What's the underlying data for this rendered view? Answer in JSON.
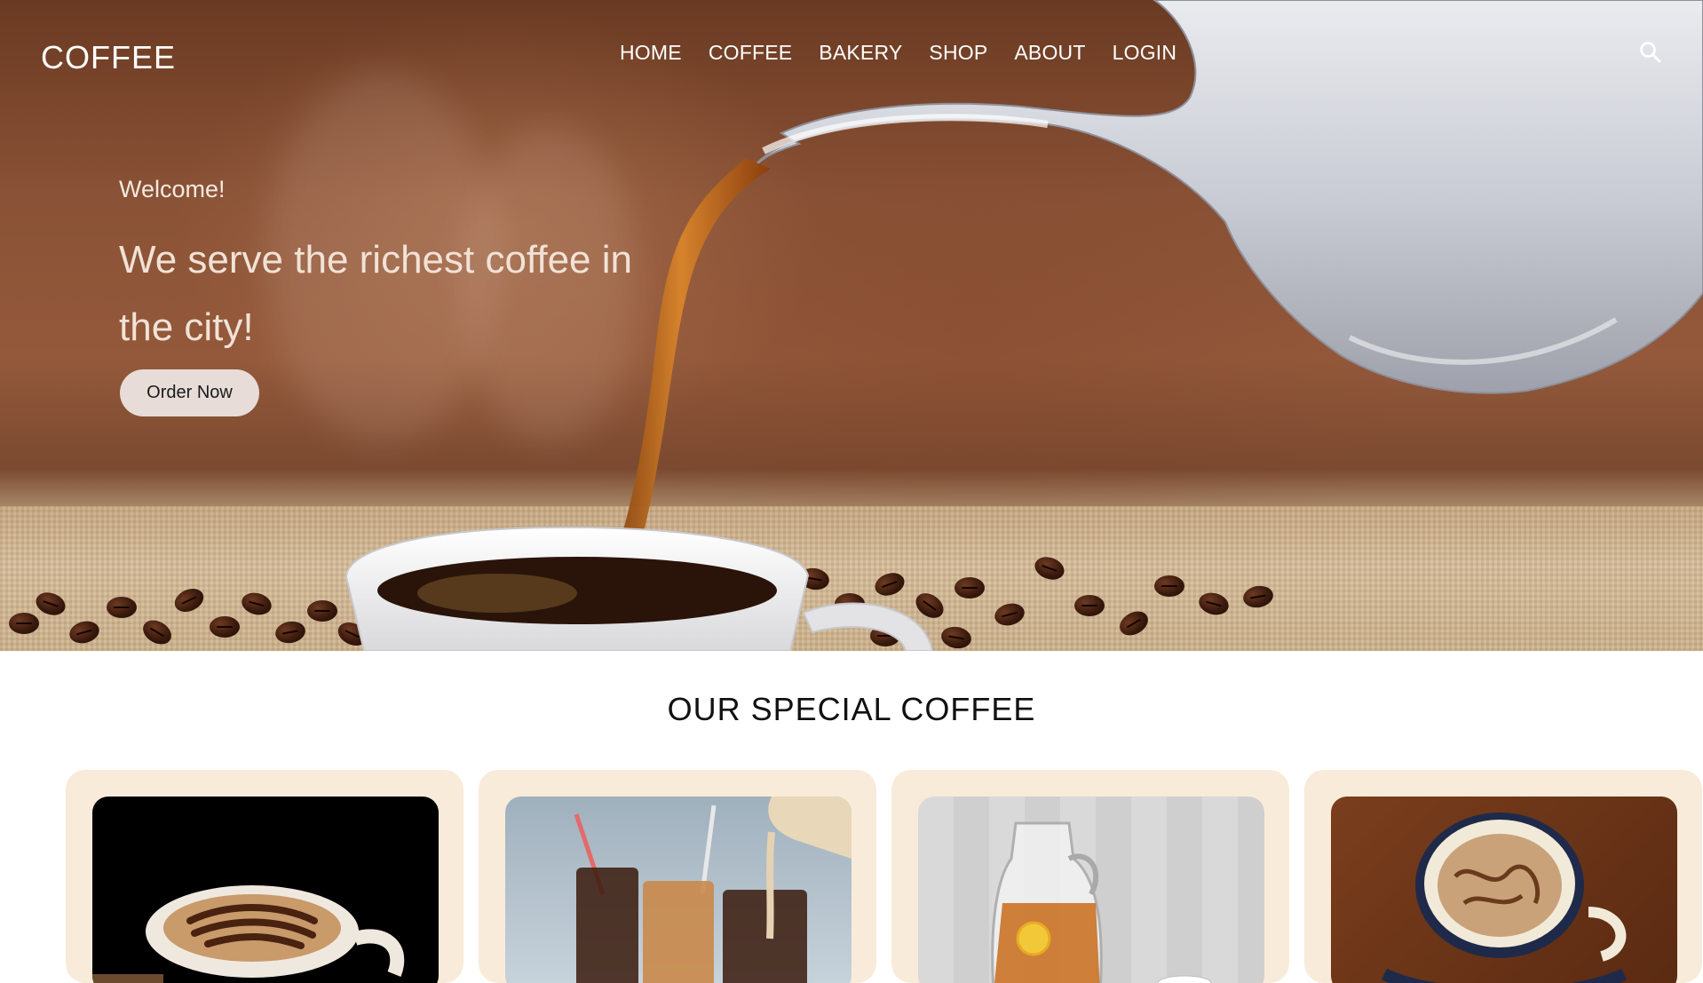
{
  "brand": {
    "logo": "COFFEE"
  },
  "nav": {
    "items": [
      {
        "label": "HOME"
      },
      {
        "label": "COFFEE"
      },
      {
        "label": "BAKERY"
      },
      {
        "label": "SHOP"
      },
      {
        "label": "ABOUT"
      },
      {
        "label": "LOGIN"
      }
    ],
    "search_icon": "search-icon"
  },
  "hero": {
    "welcome": "Welcome!",
    "headline": "We serve the richest coffee in the city!",
    "cta": "Order Now",
    "image": "coffee-pouring-from-teapot"
  },
  "special": {
    "title": "OUR SPECIAL COFFEE",
    "cards": [
      {
        "image": "latte-art-cup"
      },
      {
        "image": "iced-coffee-glasses"
      },
      {
        "image": "iced-tea-pitcher"
      },
      {
        "image": "cappuccino-cup"
      }
    ]
  },
  "colors": {
    "card_bg": "#f9ebda",
    "button_bg": "#e7dcd7",
    "nav_text": "#ffffff"
  }
}
